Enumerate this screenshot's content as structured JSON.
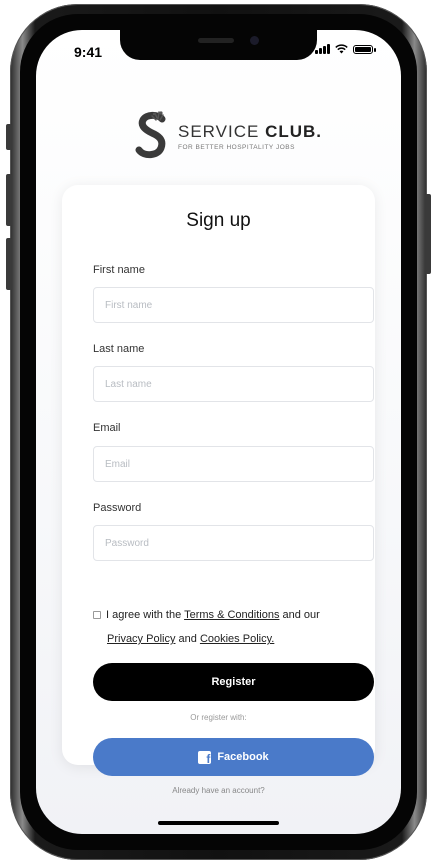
{
  "status_bar": {
    "time": "9:41"
  },
  "brand": {
    "name_light": "SERVICE ",
    "name_bold": "CLUB.",
    "tagline": "FOR BETTER HOSPITALITY JOBS"
  },
  "form": {
    "title": "Sign up",
    "fields": [
      {
        "label": "First name",
        "placeholder": "First name"
      },
      {
        "label": "Last name",
        "placeholder": "Last name"
      },
      {
        "label": "Email",
        "placeholder": "Email"
      },
      {
        "label": "Password",
        "placeholder": "Password"
      }
    ],
    "agree": {
      "prefix": "I agree with the ",
      "terms_link": "Terms & Conditions",
      "middle": " and our",
      "privacy_link": "Privacy Policy",
      "and_text": " and ",
      "cookies_link": "Cookies Policy."
    },
    "register_label": "Register",
    "or_text": "Or register with:",
    "facebook_label": "Facebook"
  },
  "footer": {
    "text": "Already have an account?"
  },
  "colors": {
    "facebook": "#4a7ac9",
    "primary_button": "#000000"
  }
}
